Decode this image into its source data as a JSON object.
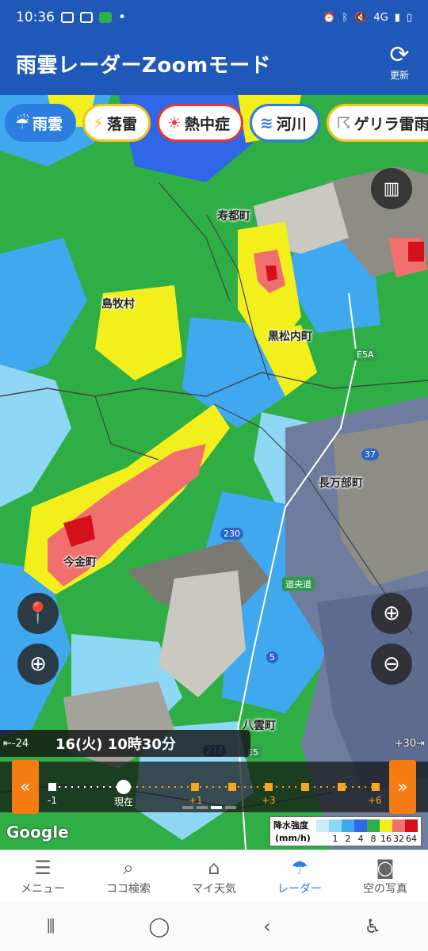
{
  "status": {
    "time": "10:36",
    "signal": "4G"
  },
  "header": {
    "title": "雨雲レーダーZoomモード",
    "refresh_label": "更新"
  },
  "chips": [
    {
      "label": "雨雲",
      "icon": "cloud-rain-icon"
    },
    {
      "label": "落雷",
      "icon": "lightning-icon"
    },
    {
      "label": "熱中症",
      "icon": "sun-icon"
    },
    {
      "label": "河川",
      "icon": "river-icon"
    },
    {
      "label": "ゲリラ雷雨",
      "icon": "thunderstorm-icon"
    }
  ],
  "map": {
    "places": [
      "寿都町",
      "島牧村",
      "黒松内町",
      "長万部町",
      "今金町",
      "八雲町"
    ],
    "roads": [
      "E5A",
      "37",
      "230",
      "5",
      "277",
      "E5",
      "道央道"
    ]
  },
  "timeline": {
    "current_time": "16(火)  10時30分",
    "minus_label": "-24",
    "plus_label": "+30",
    "ticks": [
      "-1",
      "現在",
      "+1",
      "+3",
      "+6"
    ]
  },
  "legend": {
    "title": "降水強度",
    "unit": "(mm/h)",
    "values": [
      "1",
      "2",
      "4",
      "8",
      "16",
      "32",
      "64"
    ],
    "colors": [
      "#c8ecf9",
      "#8fd8f5",
      "#3fa8ef",
      "#2f67e6",
      "#2fae45",
      "#f2ef1d",
      "#f07070",
      "#d4101a"
    ]
  },
  "attribution": "Google",
  "tabs": [
    {
      "label": "メニュー",
      "icon": "menu-icon"
    },
    {
      "label": "ココ検索",
      "icon": "search-icon"
    },
    {
      "label": "マイ天気",
      "icon": "home-icon"
    },
    {
      "label": "レーダー",
      "icon": "umbrella-icon"
    },
    {
      "label": "空の写真",
      "icon": "camera-icon"
    }
  ]
}
